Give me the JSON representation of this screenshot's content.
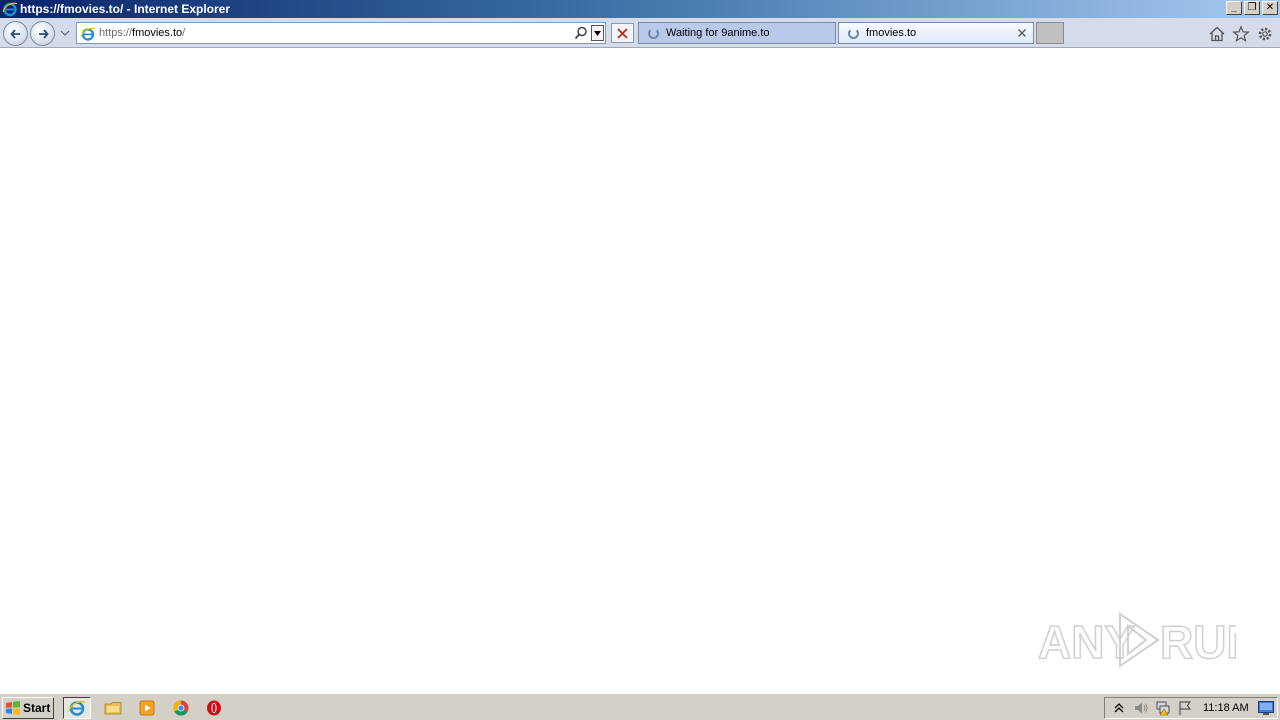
{
  "window": {
    "title": "https://fmovies.to/ - Internet Explorer",
    "controls": {
      "minimize": "_",
      "restore": "❐",
      "close": "✕"
    }
  },
  "navbar": {
    "back_icon": "back-arrow-icon",
    "forward_icon": "forward-arrow-icon",
    "address": {
      "scheme": "https://",
      "host": "fmovies.to",
      "path": "/"
    },
    "tabs": [
      {
        "label": "Waiting for 9anime.to",
        "state": "loading"
      },
      {
        "label": "fmovies.to",
        "state": "loading",
        "active": true
      }
    ],
    "command_icons": [
      "home-icon",
      "favorites-star-icon",
      "tools-gear-icon"
    ]
  },
  "watermark": {
    "text_left": "ANY",
    "text_right": "RUN"
  },
  "taskbar": {
    "start_label": "Start",
    "pinned": [
      "internet-explorer-icon",
      "file-explorer-icon",
      "media-player-icon",
      "chrome-icon",
      "opera-icon"
    ],
    "tray_icons": [
      "show-hidden-icons-icon",
      "volume-icon",
      "network-icon",
      "action-center-flag-icon"
    ],
    "clock": "11:18 AM"
  },
  "colors": {
    "titlebar_start": "#0a246a",
    "titlebar_end": "#a6caf0",
    "navbar_bg": "#d6dbe9",
    "tab_inactive": "#b9c9ec",
    "stop_red": "#c42b1c",
    "taskbar_bg": "#d4d0c8"
  }
}
